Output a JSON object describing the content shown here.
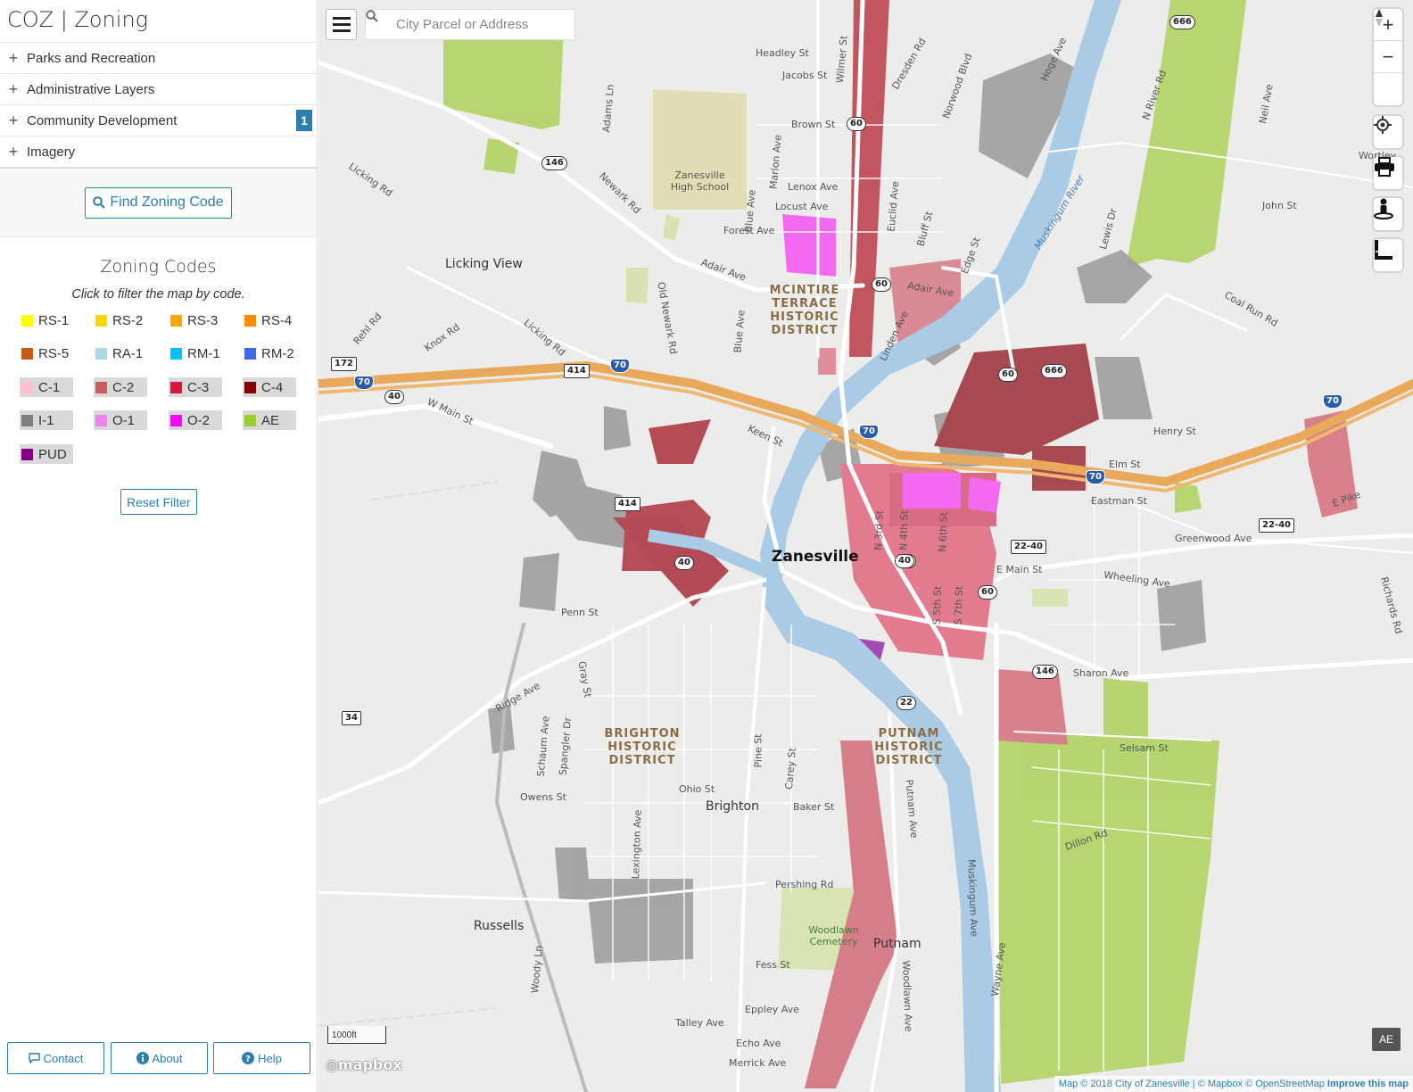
{
  "app": {
    "title": "COZ | Zoning"
  },
  "layers": [
    {
      "label": "Parks and Recreation"
    },
    {
      "label": "Administrative Layers"
    },
    {
      "label": "Community Development",
      "badge": "1"
    },
    {
      "label": "Imagery"
    }
  ],
  "find_button": {
    "label": "Find Zoning Code",
    "icon": "search-icon"
  },
  "zoning": {
    "title": "Zoning Codes",
    "subtitle": "Click to filter the map by code.",
    "codes": [
      {
        "code": "RS-1",
        "color": "#ffff00"
      },
      {
        "code": "RS-2",
        "color": "#ffd700"
      },
      {
        "code": "RS-3",
        "color": "#ffa500"
      },
      {
        "code": "RS-4",
        "color": "#ff8c00"
      },
      {
        "code": "RS-5",
        "color": "#c85a17"
      },
      {
        "code": "RA-1",
        "color": "#add8e6"
      },
      {
        "code": "RM-1",
        "color": "#00bfff"
      },
      {
        "code": "RM-2",
        "color": "#4169e1"
      },
      {
        "code": "C-1",
        "color": "#ffc0cb"
      },
      {
        "code": "C-2",
        "color": "#cd5c5c"
      },
      {
        "code": "C-3",
        "color": "#dc143c"
      },
      {
        "code": "C-4",
        "color": "#800000"
      },
      {
        "code": "I-1",
        "color": "#808080"
      },
      {
        "code": "O-1",
        "color": "#ee82ee"
      },
      {
        "code": "O-2",
        "color": "#ff00ff"
      },
      {
        "code": "AE",
        "color": "#9acd32"
      },
      {
        "code": "PUD",
        "color": "#800080"
      }
    ],
    "reset_label": "Reset Filter"
  },
  "footer": {
    "contact": "Contact",
    "about": "About",
    "help": "Help"
  },
  "map": {
    "search_placeholder": "City Parcel or Address",
    "scale": "1000ft",
    "logo": "mapbox",
    "attribution": "Map © 2018 City of Zanesville | © Mapbox © OpenStreetMap",
    "improve": "Improve this map",
    "active_filter": "AE",
    "labels": {
      "zanesville": "Zanesville",
      "brighton": "Brighton",
      "russells": "Russells",
      "putnam": "Putnam",
      "licking_view": "Licking View",
      "high_school": "Zanesville High School",
      "cemetery": "Woodlawn Cemetery",
      "river": "Muskingum River",
      "mcintire": "MCINTIRE TERRACE HISTORIC DISTRICT",
      "brighton_hd": "BRIGHTON HISTORIC DISTRICT",
      "putnam_hd": "PUTNAM HISTORIC DISTRICT",
      "streets": {
        "headley": "Headley St",
        "jacobs": "Jacobs St",
        "brown": "Brown St",
        "lenox": "Lenox Ave",
        "locust": "Locust Ave",
        "forest": "Forest Ave",
        "adair": "Adair Ave",
        "adair2": "Adair Ave",
        "newark": "Newark Rd",
        "licking_rd": "Licking Rd",
        "licking_rd2": "Licking Rd",
        "rehl": "Rehl Rd",
        "knox": "Knox Rd",
        "wmain": "W Main St",
        "keen": "Keen St",
        "penn": "Penn St",
        "ridge": "Ridge Ave",
        "gray": "Gray St",
        "schaum": "Schaum Ave",
        "spangler": "Spangler Dr",
        "owens": "Owens St",
        "ohio": "Ohio St",
        "baker": "Baker St",
        "pine": "Pine St",
        "carey": "Carey St",
        "lexington": "Lexington Ave",
        "pershing": "Pershing Rd",
        "woody": "Woody Ln",
        "fess": "Fess St",
        "eppley": "Eppley Ave",
        "talley": "Talley Ave",
        "echo": "Echo Ave",
        "merrick": "Merrick Ave",
        "putnam_ave": "Putnam Ave",
        "woodlawn": "Woodlawn Ave",
        "muskingum_ave": "Muskingum Ave",
        "wayne": "Wayne Ave",
        "dillon": "Dillon Rd",
        "selsam": "Selsam St",
        "sharon": "Sharon Ave",
        "emain": "E Main St",
        "wheeling": "Wheeling Ave",
        "greenwood": "Greenwood Ave",
        "eastman": "Eastman St",
        "elm": "Elm St",
        "henry": "Henry St",
        "epike": "E Pike",
        "richards": "Richards Rd",
        "coal_run": "Coal Run Rd",
        "john": "John St",
        "neil": "Neil Ave",
        "nriver": "N River Rd",
        "lewis": "Lewis Dr",
        "hoge": "Hoge Ave",
        "dresden": "Dresden Rd",
        "norwood": "Norwood Blvd",
        "wilmer": "Wilmer St",
        "adams": "Adams Ln",
        "marion": "Marion Ave",
        "blue": "Blue Ave",
        "blue2": "Blue Ave",
        "old_newark": "Old Newark Rd",
        "euclid": "Euclid Ave",
        "bluff": "Bluff St",
        "edge": "Edge St",
        "linden": "Linden Ave",
        "n3rd": "N 3rd St",
        "n4th": "N 4th St",
        "n6th": "N 6th St",
        "s5th": "S 5th St",
        "s7th": "S 7th St",
        "wortley": "Wortley"
      },
      "shields": {
        "s666a": "666",
        "s666b": "666",
        "s146a": "146",
        "s146b": "146",
        "s60a": "60",
        "s60b": "60",
        "s60c": "60",
        "s60d": "60",
        "s60e": "60",
        "s172": "172",
        "s70a": "70",
        "s70b": "70",
        "s70c": "70",
        "s70d": "70",
        "s70e": "70",
        "s414a": "414",
        "s414b": "414",
        "s40a": "40",
        "s40b": "40",
        "s40c": "40",
        "s2240a": "22-40",
        "s2240b": "22-40",
        "s22": "22",
        "s34": "34"
      }
    }
  }
}
